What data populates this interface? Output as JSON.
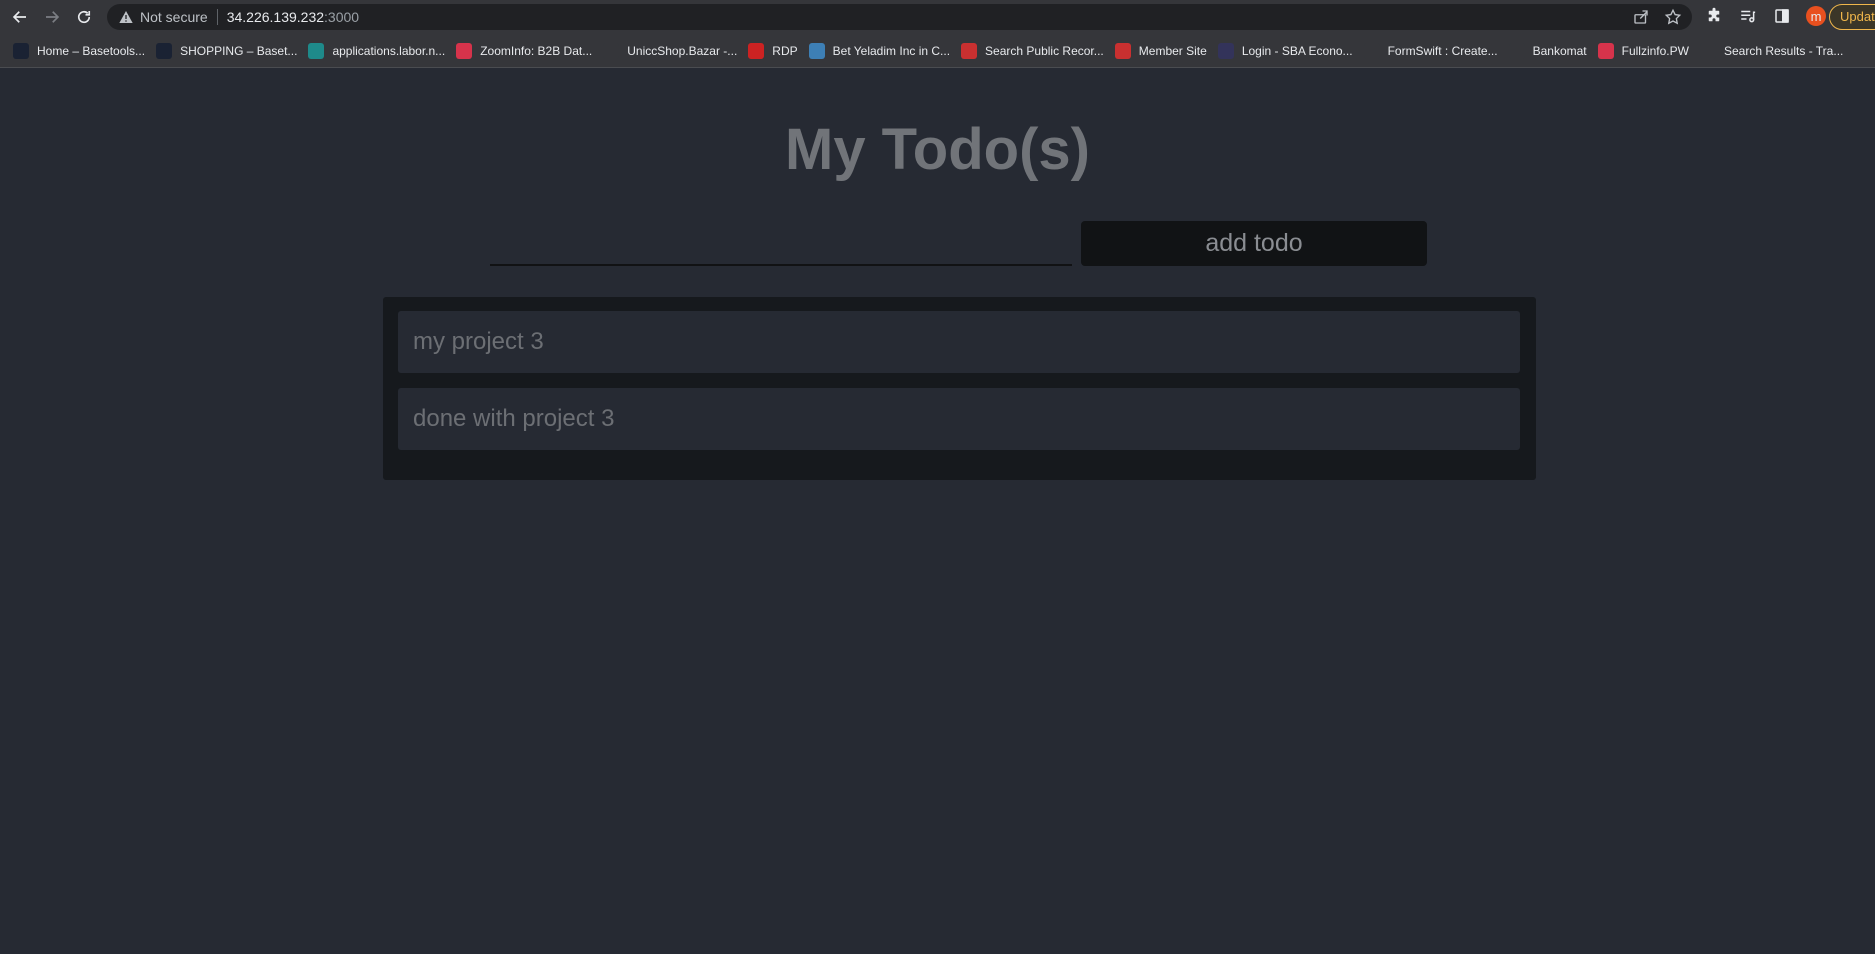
{
  "browser": {
    "security_label": "Not secure",
    "url_host": "34.226.139.232",
    "url_port": ":3000",
    "profile_initial": "m",
    "update_label": "Updat"
  },
  "bookmarks": [
    {
      "label": "Home – Basetools...",
      "icon": "basetools-icon",
      "color": "#1a2233"
    },
    {
      "label": "SHOPPING – Baset...",
      "icon": "basetools-icon",
      "color": "#1a2233"
    },
    {
      "label": "applications.labor.n...",
      "icon": "labor-icon",
      "color": "#1e8a8a"
    },
    {
      "label": "ZoomInfo: B2B Dat...",
      "icon": "zoominfo-icon",
      "color": "#d6334b"
    },
    {
      "label": "UniccShop.Bazar -...",
      "icon": "copyright-icon",
      "color": "#35363a"
    },
    {
      "label": "RDP",
      "icon": "redhat-icon",
      "color": "#cc2222"
    },
    {
      "label": "Bet Yeladim Inc in C...",
      "icon": "bet-yeladim-icon",
      "color": "#3d7fb5"
    },
    {
      "label": "Search Public Recor...",
      "icon": "records-icon",
      "color": "#c93030"
    },
    {
      "label": "Member Site",
      "icon": "member-site-icon",
      "color": "#c93030"
    },
    {
      "label": "Login - SBA Econo...",
      "icon": "sba-icon",
      "color": "#33335a"
    },
    {
      "label": "FormSwift : Create...",
      "icon": "formswift-icon",
      "color": "#35363a"
    },
    {
      "label": "Bankomat",
      "icon": "globe-icon",
      "color": "#35363a"
    },
    {
      "label": "Fullzinfo.PW",
      "icon": "fullzinfo-icon",
      "color": "#d6334b"
    },
    {
      "label": "Search Results - Tra...",
      "icon": "search-results-icon",
      "color": "#35363a"
    }
  ],
  "app": {
    "title": "My Todo(s)",
    "input_value": "",
    "add_button_label": "add todo",
    "todos": [
      "my project 3",
      "done with project 3"
    ]
  }
}
